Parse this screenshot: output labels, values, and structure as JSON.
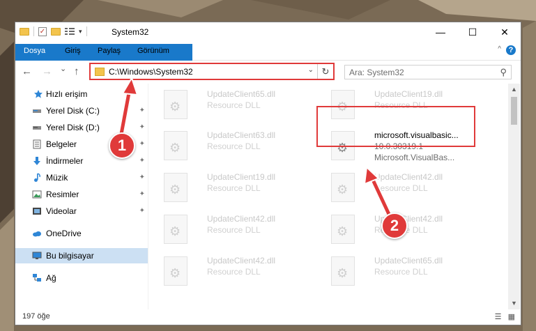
{
  "window": {
    "title": "System32",
    "minimize_glyph": "—",
    "maximize_glyph": "☐",
    "close_glyph": "✕"
  },
  "ribbon": {
    "tabs": [
      "Dosya",
      "Giriş",
      "Paylaş",
      "Görünüm"
    ],
    "active_tab": "Dosya",
    "help_glyph": "?",
    "collapse_glyph": "^"
  },
  "nav": {
    "back_glyph": "←",
    "forward_glyph": "→",
    "recent_glyph": "⌄",
    "up_glyph": "↑",
    "address": "C:\\Windows\\System32",
    "address_caret": "⌄",
    "refresh_glyph": "↻",
    "search_placeholder": "Ara: System32",
    "search_glyph": "⚲"
  },
  "sidebar": {
    "items": [
      {
        "label": "Hızlı erişim",
        "icon": "star-icon",
        "pinned": false,
        "selected": false
      },
      {
        "label": "Yerel Disk (C:)",
        "icon": "drive-icon",
        "pinned": true,
        "selected": false
      },
      {
        "label": "Yerel Disk (D:)",
        "icon": "drive-icon",
        "pinned": true,
        "selected": false
      },
      {
        "label": "Belgeler",
        "icon": "documents-icon",
        "pinned": true,
        "selected": false
      },
      {
        "label": "İndirmeler",
        "icon": "download-icon",
        "pinned": true,
        "selected": false
      },
      {
        "label": "Müzik",
        "icon": "music-icon",
        "pinned": true,
        "selected": false
      },
      {
        "label": "Resimler",
        "icon": "pictures-icon",
        "pinned": true,
        "selected": false
      },
      {
        "label": "Videolar",
        "icon": "videos-icon",
        "pinned": true,
        "selected": false
      },
      {
        "label": "OneDrive",
        "icon": "cloud-icon",
        "pinned": false,
        "selected": false
      },
      {
        "label": "Bu bilgisayar",
        "icon": "computer-icon",
        "pinned": false,
        "selected": true
      },
      {
        "label": "Ağ",
        "icon": "network-icon",
        "pinned": false,
        "selected": false
      }
    ],
    "pin_glyph": "📌"
  },
  "files": [
    {
      "name": "UpdateClient65.dll",
      "line2": "Resource DLL",
      "line3": ""
    },
    {
      "name": "UpdateClient19.dll",
      "line2": "Resource DLL",
      "line3": ""
    },
    {
      "name": "UpdateClient63.dll",
      "line2": "Resource DLL",
      "line3": ""
    },
    {
      "name": "microsoft.visualbasic...",
      "line2": "10.0.30319.1",
      "line3": "Microsoft.VisualBas...",
      "highlighted": true
    },
    {
      "name": "UpdateClient19.dll",
      "line2": "Resource DLL",
      "line3": ""
    },
    {
      "name": "UpdateClient42.dll",
      "line2": "Resource DLL",
      "line3": ""
    },
    {
      "name": "UpdateClient42.dll",
      "line2": "Resource DLL",
      "line3": ""
    },
    {
      "name": "UpdateClient42.dll",
      "line2": "Resource DLL",
      "line3": ""
    },
    {
      "name": "UpdateClient42.dll",
      "line2": "Resource DLL",
      "line3": ""
    },
    {
      "name": "UpdateClient65.dll",
      "line2": "Resource DLL",
      "line3": ""
    }
  ],
  "status": {
    "item_count": "197 öğe"
  },
  "annotations": {
    "step1": "1",
    "step2": "2",
    "color": "#e03a3a"
  },
  "colors": {
    "accent": "#1979ca",
    "selection": "#cce0f3",
    "highlight": "#e03a3a"
  }
}
